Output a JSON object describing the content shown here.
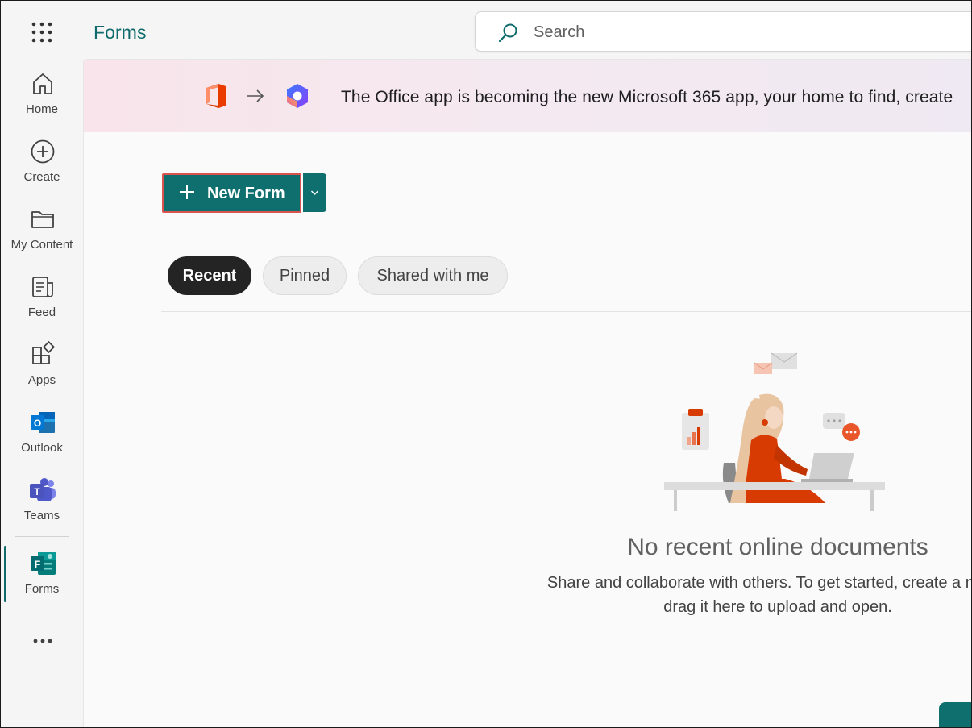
{
  "app": {
    "title": "Forms"
  },
  "search": {
    "placeholder": "Search"
  },
  "rail": {
    "items": [
      {
        "label": "Home",
        "icon": "home-icon"
      },
      {
        "label": "Create",
        "icon": "plus-circle-icon"
      },
      {
        "label": "My Content",
        "icon": "folder-icon"
      },
      {
        "label": "Feed",
        "icon": "feed-icon"
      },
      {
        "label": "Apps",
        "icon": "apps-icon"
      },
      {
        "label": "Outlook",
        "icon": "outlook-icon"
      },
      {
        "label": "Teams",
        "icon": "teams-icon"
      },
      {
        "label": "Forms",
        "icon": "forms-icon",
        "active": true
      }
    ],
    "more_icon": "more-icon"
  },
  "banner": {
    "text": "The Office app is becoming the new Microsoft 365 app, your home to find, create"
  },
  "actions": {
    "new_form_label": "New Form"
  },
  "tabs": [
    {
      "label": "Recent",
      "active": true
    },
    {
      "label": "Pinned",
      "active": false
    },
    {
      "label": "Shared with me",
      "active": false
    }
  ],
  "empty_state": {
    "title": "No recent online documents",
    "line1": "Share and collaborate with others. To get started, create a new d",
    "line2": "drag it here to upload and open."
  },
  "colors": {
    "accent": "#0f6e6e",
    "brand_text": "#0f6b6b",
    "highlight_border": "#d9534f",
    "active_tab": "#242424"
  }
}
